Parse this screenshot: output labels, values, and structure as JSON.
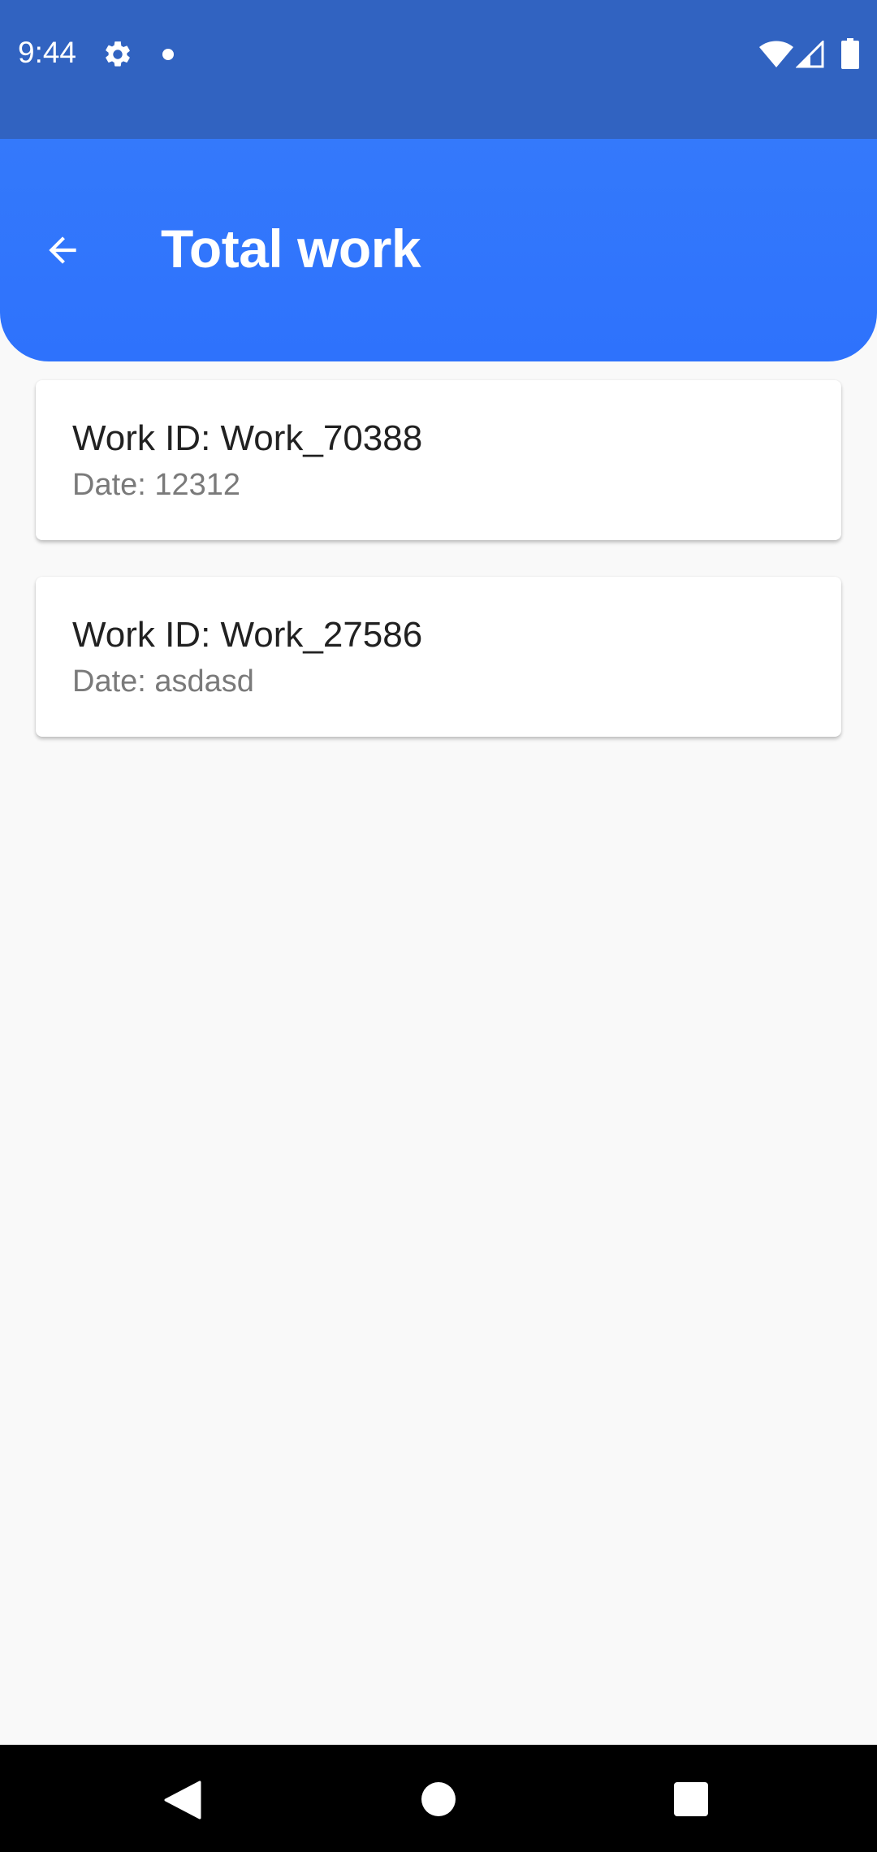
{
  "status_bar": {
    "time": "9:44",
    "icons": [
      "gear-icon",
      "dot-icon",
      "wifi-icon",
      "signal-icon",
      "battery-icon"
    ],
    "background": "#3163c1"
  },
  "app_bar": {
    "title": "Total work",
    "back_icon": "arrow-back-icon",
    "background": "#2e72fc"
  },
  "work_items": [
    {
      "work_id": "Work ID: Work_70388",
      "date": "Date: 12312"
    },
    {
      "work_id": "Work ID: Work_27586",
      "date": "Date: asdasd"
    }
  ],
  "nav_bar": {
    "icons": [
      "back-triangle-icon",
      "home-circle-icon",
      "recents-square-icon"
    ]
  }
}
